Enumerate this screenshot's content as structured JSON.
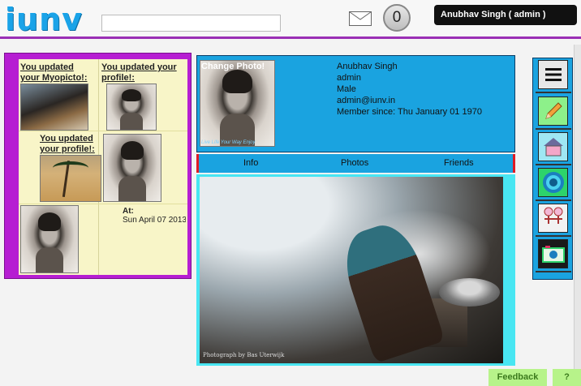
{
  "header": {
    "logo": "iunv",
    "search_value": "",
    "message_count": "0",
    "user_label": "Anubhav Singh ( admin )"
  },
  "activity": {
    "item1": "You updated your Myopicto!:",
    "item2": "You updated your profile!:",
    "item3": "You updated your profile!:",
    "at_label": "At:",
    "at_value": "Sun April 07 2013",
    "watermark": "Live Life Your Way Enjoy"
  },
  "profile": {
    "change_photo": "Change Photo!",
    "name": "Anubhav Singh",
    "role": "admin",
    "gender": "Male",
    "email": "admin@iunv.in",
    "member_since": "Member since: Thu January 01 1970"
  },
  "tabs": [
    "Info",
    "Photos",
    "Friends"
  ],
  "main_photo": {
    "credit": "Photograph by Bas Uterwijk"
  },
  "right_rail": [
    "menu-icon",
    "pencil-icon",
    "home-icon",
    "target-icon",
    "people-icon",
    "camera-icon"
  ],
  "footer": {
    "feedback": "Feedback",
    "help": "?"
  },
  "colors": {
    "accent_purple": "#b61ed2",
    "accent_blue": "#1aa3e0",
    "tab_border": "#e01b24",
    "photo_frame": "#48e6f2",
    "feedback_bg": "#b7f38a"
  }
}
